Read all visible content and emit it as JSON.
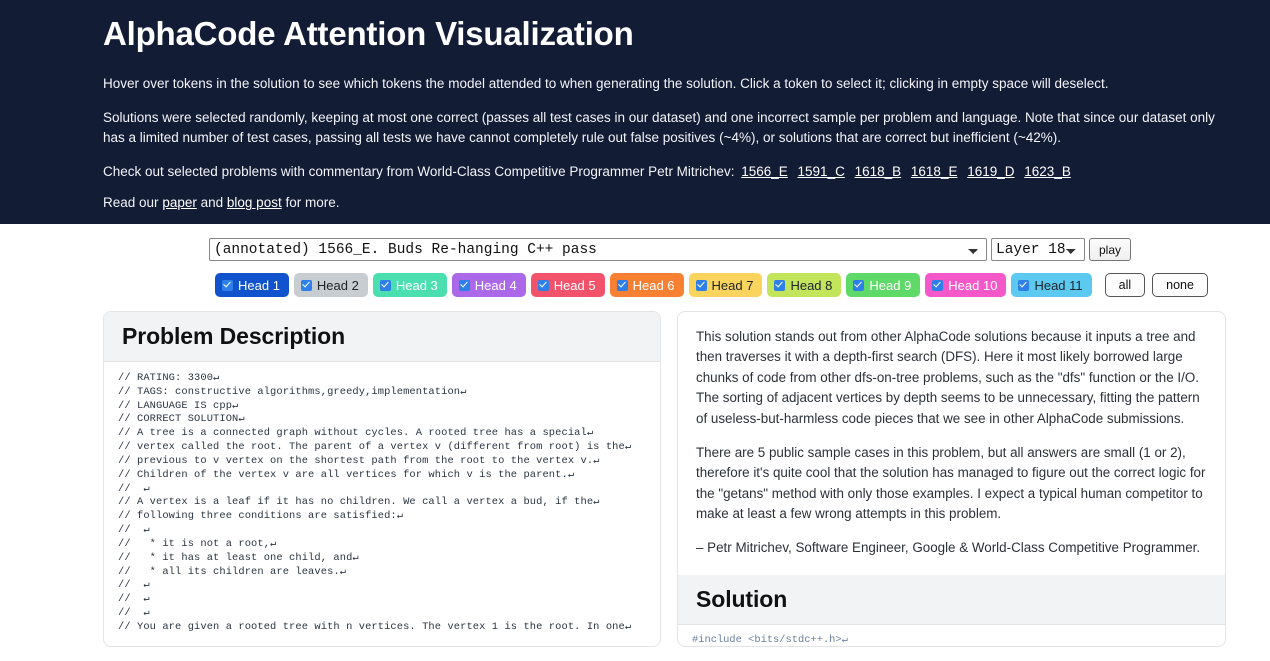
{
  "header": {
    "title": "AlphaCode Attention Visualization",
    "paragraph1": "Hover over tokens in the solution to see which tokens the model attended to when generating the solution. Click a token to select it; clicking in empty space will deselect.",
    "paragraph2": "Solutions were selected randomly, keeping at most one correct (passes all test cases in our dataset) and one incorrect sample per problem and language. Note that since our dataset only has a limited number of test cases, passing all tests we have cannot completely rule out false positives (~4%), or solutions that are correct but inefficient (~42%).",
    "paragraph3_prefix": "Check out selected problems with commentary from World-Class Competitive Programmer Petr Mitrichev:",
    "problem_links": [
      "1566_E",
      "1591_C",
      "1618_B",
      "1618_E",
      "1619_D",
      "1623_B"
    ],
    "read_prefix": "Read our",
    "paper_link": "paper",
    "read_mid": "and",
    "blog_link": "blog post",
    "read_suffix": "for more.",
    "bg_color": "#131c35"
  },
  "controls": {
    "problem_select_value": "(annotated) 1566_E. Buds Re-hanging",
    "language_value": "C++",
    "status_value": "pass",
    "layer_select_value": "Layer 18",
    "play_button": "play"
  },
  "heads": {
    "buttons": [
      {
        "label": "Head 1",
        "color": "#1053cc",
        "text_color": "#ffffff"
      },
      {
        "label": "Head 2",
        "color": "#c8cdd2",
        "text_color": "#20252b"
      },
      {
        "label": "Head 3",
        "color": "#4bdfb0",
        "text_color": "#ffffff"
      },
      {
        "label": "Head 4",
        "color": "#ab68e8",
        "text_color": "#ffffff"
      },
      {
        "label": "Head 5",
        "color": "#f2536b",
        "text_color": "#ffffff"
      },
      {
        "label": "Head 6",
        "color": "#f78033",
        "text_color": "#ffffff"
      },
      {
        "label": "Head 7",
        "color": "#fad45c",
        "text_color": "#20252b"
      },
      {
        "label": "Head 8",
        "color": "#c2e55c",
        "text_color": "#20252b"
      },
      {
        "label": "Head 9",
        "color": "#5fd968",
        "text_color": "#ffffff"
      },
      {
        "label": "Head 10",
        "color": "#f558c8",
        "text_color": "#ffffff"
      },
      {
        "label": "Head 11",
        "color": "#5ccaf0",
        "text_color": "#20252b"
      }
    ],
    "all_label": "all",
    "none_label": "none"
  },
  "problem_panel": {
    "title": "Problem Description",
    "code": "// RATING: 3300↵\n// TAGS: constructive algorithms,greedy,implementation↵\n// LANGUAGE IS cpp↵\n// CORRECT SOLUTION↵\n// A tree is a connected graph without cycles. A rooted tree has a special↵\n// vertex called the root. The parent of a vertex v (different from root) is the↵\n// previous to v vertex on the shortest path from the root to the vertex v.↵\n// Children of the vertex v are all vertices for which v is the parent.↵\n//  ↵\n// A vertex is a leaf if it has no children. We call a vertex a bud, if the↵\n// following three conditions are satisfied:↵\n//  ↵\n//   * it is not a root,↵\n//   * it has at least one child, and↵\n//   * all its children are leaves.↵\n//  ↵\n//  ↵\n//  ↵\n// You are given a rooted tree with n vertices. The vertex 1 is the root. In one↵"
  },
  "solution_panel": {
    "commentary": [
      "This solution stands out from other AlphaCode solutions because it inputs a tree and then traverses it with a depth-first search (DFS). Here it most likely borrowed large chunks of code from other dfs-on-tree problems, such as the \"dfs\" function or the I/O. The sorting of adjacent vertices by depth seems to be unnecessary, fitting the pattern of useless-but-harmless code pieces that we see in other AlphaCode submissions.",
      "There are 5 public sample cases in this problem, but all answers are small (1 or 2), therefore it's quite cool that the solution has managed to figure out the correct logic for the \"getans\" method with only those examples. I expect a typical human competitor to make at least a few wrong attempts in this problem."
    ],
    "signature": "– Petr Mitrichev, Software Engineer, Google & World-Class Competitive Programmer.",
    "title": "Solution",
    "code": "#include <bits/stdc++.h>↵"
  }
}
